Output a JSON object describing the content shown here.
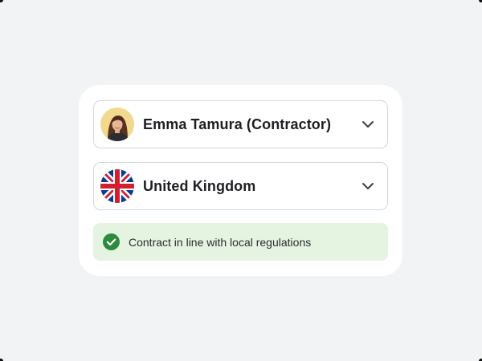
{
  "person_select": {
    "name": "Emma Tamura (Contractor)",
    "avatar_icon": "user-photo"
  },
  "country_select": {
    "name": "United Kingdom",
    "flag_icon": "uk-flag-icon"
  },
  "notice": {
    "text": "Contract in line with local regulations",
    "icon": "check-circle-icon",
    "background": "#e4f4e1",
    "icon_color": "#2e8a3e"
  },
  "colors": {
    "page_bg": "#f1f3f4",
    "card_bg": "#ffffff",
    "border": "#d3d6da"
  }
}
